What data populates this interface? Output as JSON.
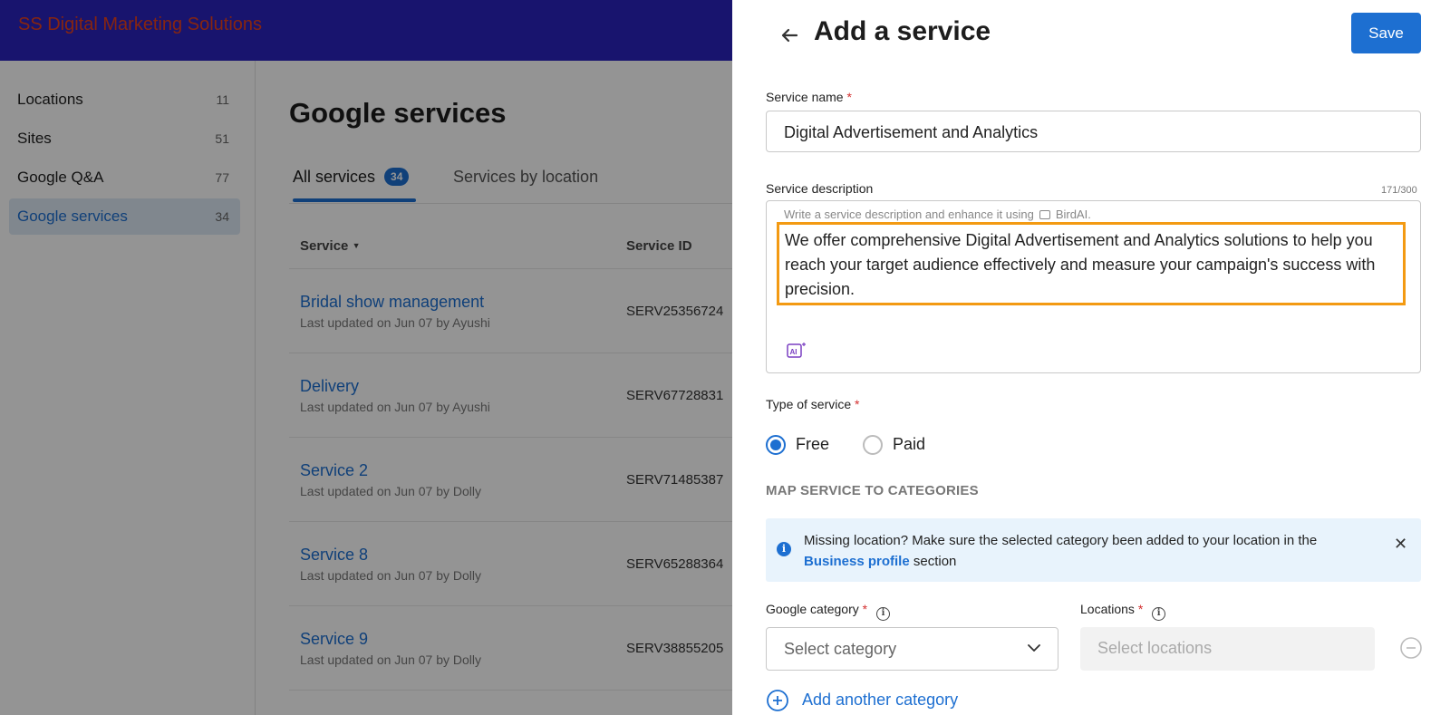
{
  "app": {
    "brand": "SS Digital Marketing Solutions"
  },
  "sidebar": {
    "items": [
      {
        "label": "Locations",
        "count": "11"
      },
      {
        "label": "Sites",
        "count": "51"
      },
      {
        "label": "Google Q&A",
        "count": "77"
      },
      {
        "label": "Google services",
        "count": "34",
        "active": true
      }
    ]
  },
  "main": {
    "title": "Google services",
    "tabs": [
      {
        "label": "All services",
        "badge": "34",
        "active": true
      },
      {
        "label": "Services by location"
      }
    ],
    "columns": {
      "service": "Service",
      "service_id": "Service ID"
    },
    "rows": [
      {
        "name": "Bridal show management",
        "updated": "Last updated on Jun 07 by Ayushi",
        "id": "SERV25356724"
      },
      {
        "name": "Delivery",
        "updated": "Last updated on Jun 07 by Ayushi",
        "id": "SERV67728831"
      },
      {
        "name": "Service 2",
        "updated": "Last updated on Jun 07 by Dolly",
        "id": "SERV71485387"
      },
      {
        "name": "Service 8",
        "updated": "Last updated on Jun 07 by Dolly",
        "id": "SERV65288364"
      },
      {
        "name": "Service 9",
        "updated": "Last updated on Jun 07 by Dolly",
        "id": "SERV38855205"
      }
    ]
  },
  "drawer": {
    "title": "Add a service",
    "save_label": "Save",
    "service_name": {
      "label": "Service name",
      "required": "*",
      "value": "Digital Advertisement and Analytics"
    },
    "service_description": {
      "label": "Service description",
      "counter": "171/300",
      "hint_prefix": "Write a service description and enhance it using",
      "hint_brand": "BirdAI.",
      "value": "We offer comprehensive Digital Advertisement and Analytics solutions to help you reach your target audience effectively and measure your campaign's success with precision."
    },
    "type_of_service": {
      "label": "Type of service",
      "required": "*",
      "options": [
        "Free",
        "Paid"
      ],
      "selected": "Free"
    },
    "categories_section": "MAP SERVICE TO CATEGORIES",
    "notice": {
      "text": "Missing location? Make sure the selected category been added to your location in the",
      "link": "Business profile",
      "suffix": "section"
    },
    "google_category": {
      "label": "Google category",
      "required": "*",
      "placeholder": "Select category"
    },
    "locations": {
      "label": "Locations",
      "required": "*",
      "placeholder": "Select locations"
    },
    "add_category_label": "Add another category"
  },
  "colors": {
    "topbar": "#2a23bd",
    "brand_text": "#e8401c",
    "accent": "#1d6fd1",
    "highlight_border": "#f39a12"
  }
}
